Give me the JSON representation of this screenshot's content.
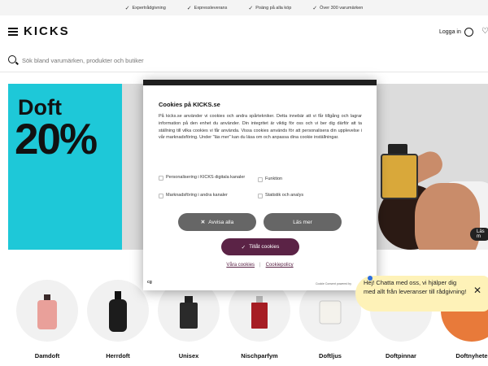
{
  "top_bar": {
    "usps": [
      "Expertrådgivning",
      "Expressleverans",
      "Poäng på alla köp",
      "Över 300 varumärken"
    ]
  },
  "header": {
    "logo": "KICKS",
    "login_label": "Logga in"
  },
  "search": {
    "placeholder": "Sök bland varumärken, produkter och butiker"
  },
  "hero": {
    "word": "Doft",
    "percent": "20%",
    "read_more": "Läs m"
  },
  "categories": [
    "Damdoft",
    "Herrdoft",
    "Unisex",
    "Nischparfym",
    "Doftljus",
    "Doftpinnar",
    "Doftnyhete"
  ],
  "cookie_modal": {
    "title": "Cookies på KICKS.se",
    "body": "På kicks.se använder vi cookies och andra spårtekniker. Detta innebär att vi får tillgång och lagrar information på den enhet du använder. Din integritet är viktig för oss och vi ber dig därför att ta ställning till vilka cookies vi får använda. Vissa cookies används för att personalisera din upplevelse i vår marknadsföring. Under \"läs mer\" kan du läsa om och anpassa dina cookie inställningar.",
    "options": [
      "Personalisering i KICKS digitala kanaler",
      "Funktion",
      "Marknadsföring i andra kanaler",
      "Statistik och analys"
    ],
    "reject_label": "Avvisa alla",
    "read_more_label": "Läs mer",
    "accept_label": "Tillåt cookies",
    "link_cookies": "Våra cookies",
    "link_policy": "Cookiepolicy",
    "powered_by": "Cookie Consent powered by",
    "brand_mark": "cg"
  },
  "chat": {
    "message": "Hej! Chatta med oss, vi hjälper dig med allt från leveranser till rådgivning!"
  },
  "colors": {
    "hero_cyan": "#1ec8d8",
    "accept_purple": "#5b2346",
    "chat_yellow": "#fef2b8"
  }
}
